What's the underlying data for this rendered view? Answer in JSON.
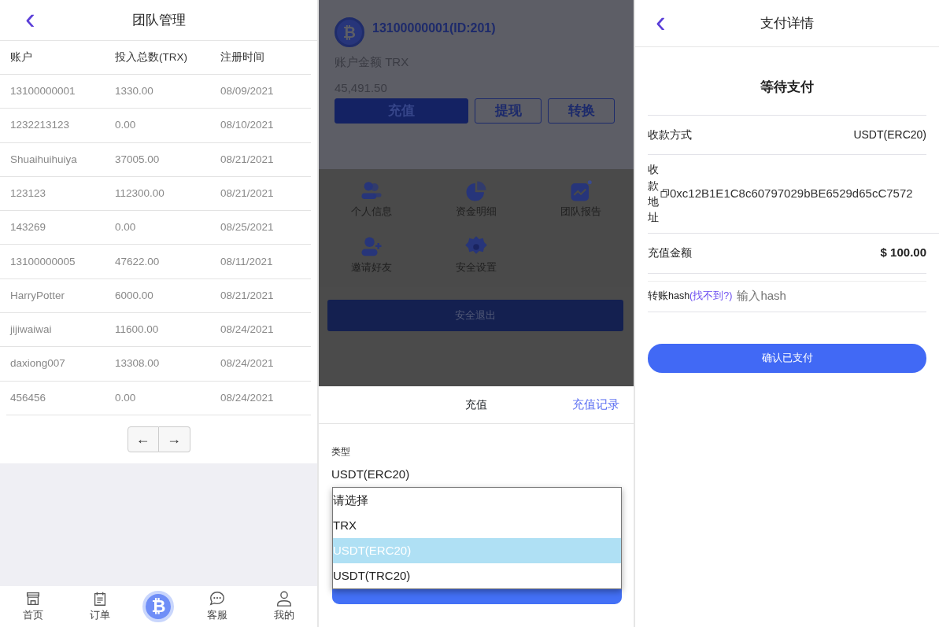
{
  "team_page": {
    "title": "团队管理",
    "back": "‹",
    "table": {
      "columns": [
        "账户",
        "投入总数(TRX)",
        "注册时间"
      ],
      "rows": [
        [
          "13100000001",
          "1330.00",
          "08/09/2021"
        ],
        [
          "1232213123",
          "0.00",
          "08/10/2021"
        ],
        [
          "Shuaihuihuiya",
          "37005.00",
          "08/21/2021"
        ],
        [
          "123123",
          "112300.00",
          "08/21/2021"
        ],
        [
          "143269",
          "0.00",
          "08/25/2021"
        ],
        [
          "13100000005",
          "47622.00",
          "08/11/2021"
        ],
        [
          "HarryPotter",
          "6000.00",
          "08/21/2021"
        ],
        [
          "jijiwaiwai",
          "11600.00",
          "08/24/2021"
        ],
        [
          "daxiong007",
          "13308.00",
          "08/24/2021"
        ],
        [
          "456456",
          "0.00",
          "08/24/2021"
        ]
      ]
    },
    "pagination": [
      "←",
      "→"
    ],
    "bottom_nav": [
      {
        "kind": "store",
        "label": "首页"
      },
      {
        "kind": "notes",
        "label": "订单"
      },
      {
        "kind": "logo",
        "glyph": "₿"
      },
      {
        "kind": "chat",
        "label": "客服"
      },
      {
        "kind": "user",
        "label": "我的"
      }
    ]
  },
  "profile_page": {
    "logo_glyph": "₿",
    "account": "13100000001(ID:201)",
    "balance_label": "账户金额 TRX",
    "balance": "45,491.50",
    "actions": [
      {
        "label": "充值",
        "primary": true
      },
      {
        "label": "提现",
        "primary": false
      },
      {
        "label": "转换",
        "primary": false
      }
    ],
    "menu": [
      {
        "kind": "people",
        "label": "个人信息"
      },
      {
        "kind": "pie",
        "label": "资金明细"
      },
      {
        "kind": "chart",
        "label": "团队报告"
      },
      {
        "kind": "adduser",
        "label": "邀请好友"
      },
      {
        "kind": "gear",
        "label": "安全设置"
      }
    ],
    "logout": "安全退出"
  },
  "recharge_sheet": {
    "title": "充值",
    "history_link": "充值记录",
    "type_label": "类型",
    "type_value": "USDT(ERC20)",
    "options": [
      {
        "label": "请选择",
        "selected": false
      },
      {
        "label": "TRX",
        "selected": false
      },
      {
        "label": "USDT(ERC20)",
        "selected": true
      },
      {
        "label": "USDT(TRC20)",
        "selected": false
      }
    ],
    "submit_button": true
  },
  "payment_page": {
    "title": "支付详情",
    "back": "‹",
    "status": "等待支付",
    "method_label": "收款方式",
    "method_value": "USDT(ERC20)",
    "address_label": "收款地址",
    "address": "0xc12B1E1C8c60797029bBE6529d65cC7572",
    "amount_label": "充值金额",
    "amount": "$ 100.00",
    "hash_label": "转账hash",
    "hash_help": "(找不到?)",
    "hash_placeholder": "输入hash",
    "confirm": "确认已支付"
  }
}
